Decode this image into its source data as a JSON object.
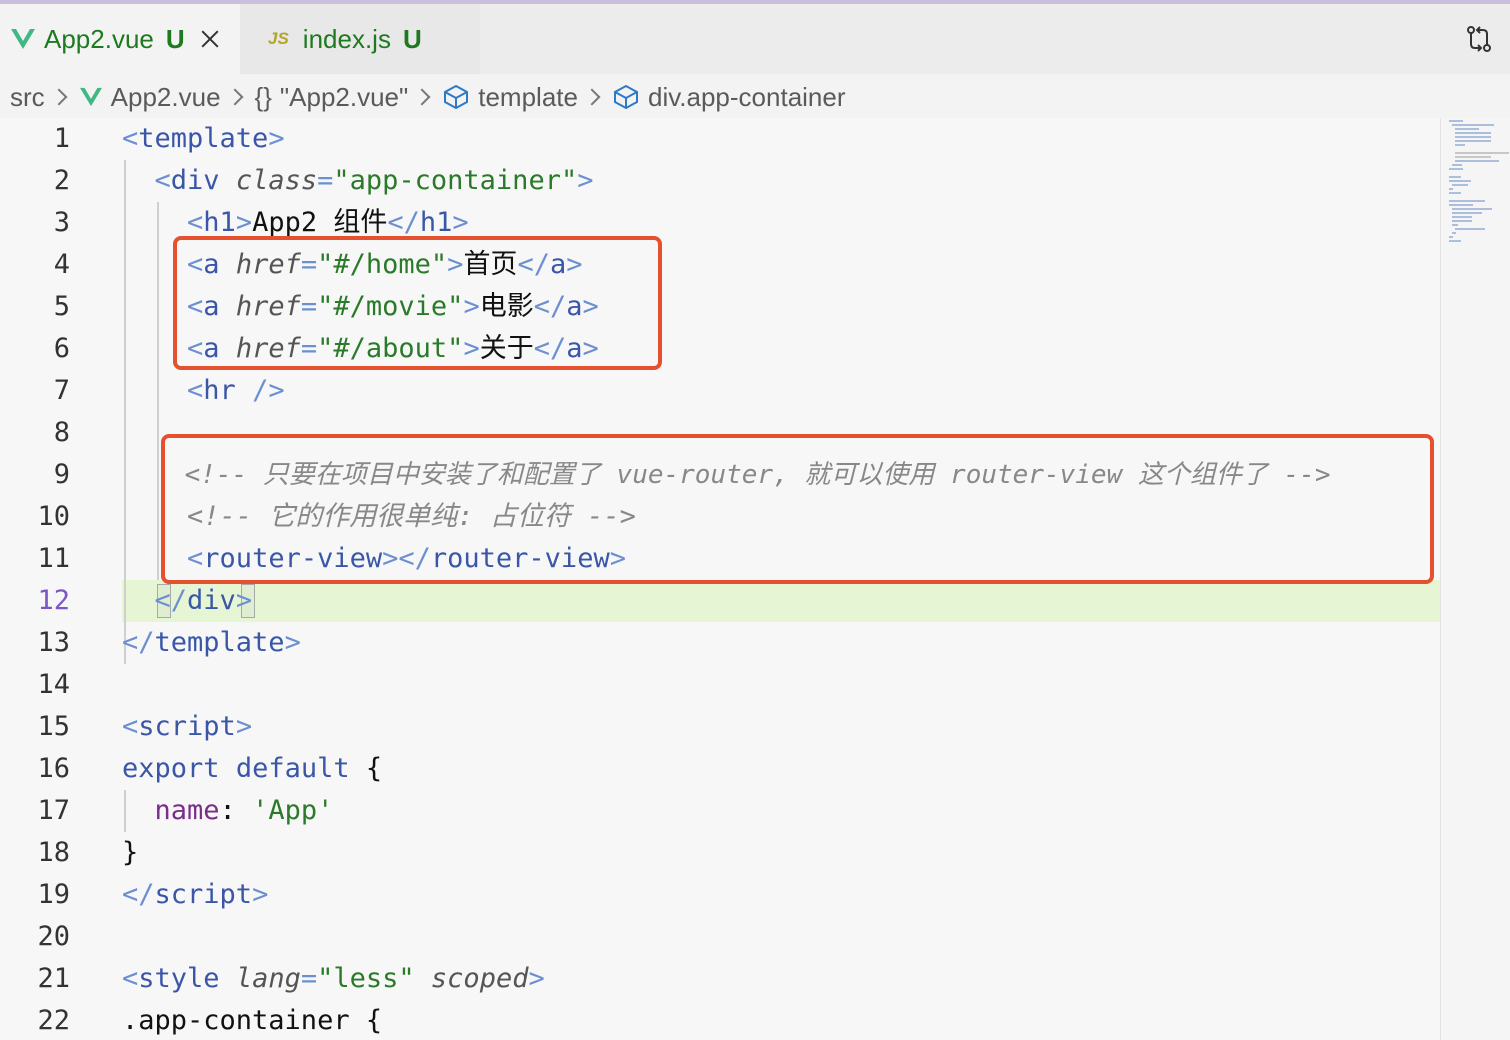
{
  "tabs": [
    {
      "label": "App2.vue",
      "status": "U",
      "icon": "vue-icon",
      "active": true
    },
    {
      "label": "index.js",
      "status": "U",
      "icon": "js-icon",
      "icon_text": "JS",
      "active": false
    }
  ],
  "breadcrumb": {
    "src": "src",
    "file": "App2.vue",
    "braces": "{}",
    "object": "\"App2.vue\"",
    "template": "template",
    "container": "div.app-container"
  },
  "editor": {
    "current_line": 12,
    "lines": [
      {
        "n": "1"
      },
      {
        "n": "2"
      },
      {
        "n": "3"
      },
      {
        "n": "4"
      },
      {
        "n": "5"
      },
      {
        "n": "6"
      },
      {
        "n": "7"
      },
      {
        "n": "8"
      },
      {
        "n": "9"
      },
      {
        "n": "10"
      },
      {
        "n": "11"
      },
      {
        "n": "12"
      },
      {
        "n": "13"
      },
      {
        "n": "14"
      },
      {
        "n": "15"
      },
      {
        "n": "16"
      },
      {
        "n": "17"
      },
      {
        "n": "18"
      },
      {
        "n": "19"
      },
      {
        "n": "20"
      },
      {
        "n": "21"
      },
      {
        "n": "22"
      }
    ],
    "code": {
      "l1_tag": "template",
      "l2_tag": "div",
      "l2_attr": "class",
      "l2_val": "\"app-container\"",
      "l3_tag": "h1",
      "l3_text": "App2 组件",
      "l3_close": "h1",
      "l4_tag": "a",
      "l4_attr": "href",
      "l4_val": "\"#/home\"",
      "l4_text": "首页",
      "l4_close": "a",
      "l5_tag": "a",
      "l5_attr": "href",
      "l5_val": "\"#/movie\"",
      "l5_text": "电影",
      "l5_close": "a",
      "l6_tag": "a",
      "l6_attr": "href",
      "l6_val": "\"#/about\"",
      "l6_text": "关于",
      "l6_close": "a",
      "l7_tag": "hr",
      "l9_comment": "<!-- 只要在项目中安装了和配置了 vue-router, 就可以使用 router-view 这个组件了 -->",
      "l10_comment": "<!-- 它的作用很单纯: 占位符 -->",
      "l11_tag": "router-view",
      "l11_close": "router-view",
      "l12_tag": "div",
      "l13_tag": "template",
      "l15_tag": "script",
      "l16_kw1": "export",
      "l16_kw2": "default",
      "l16_brace": "{",
      "l17_prop": "name",
      "l17_colon": ":",
      "l17_val": "'App'",
      "l18_brace": "}",
      "l19_tag": "script",
      "l21_tag": "style",
      "l21_attr1": "lang",
      "l21_val": "\"less\"",
      "l21_attr2": "scoped",
      "l22_selector": ".app-container",
      "l22_brace": "{"
    }
  },
  "annotations": {
    "box_color": "#e5502e"
  }
}
